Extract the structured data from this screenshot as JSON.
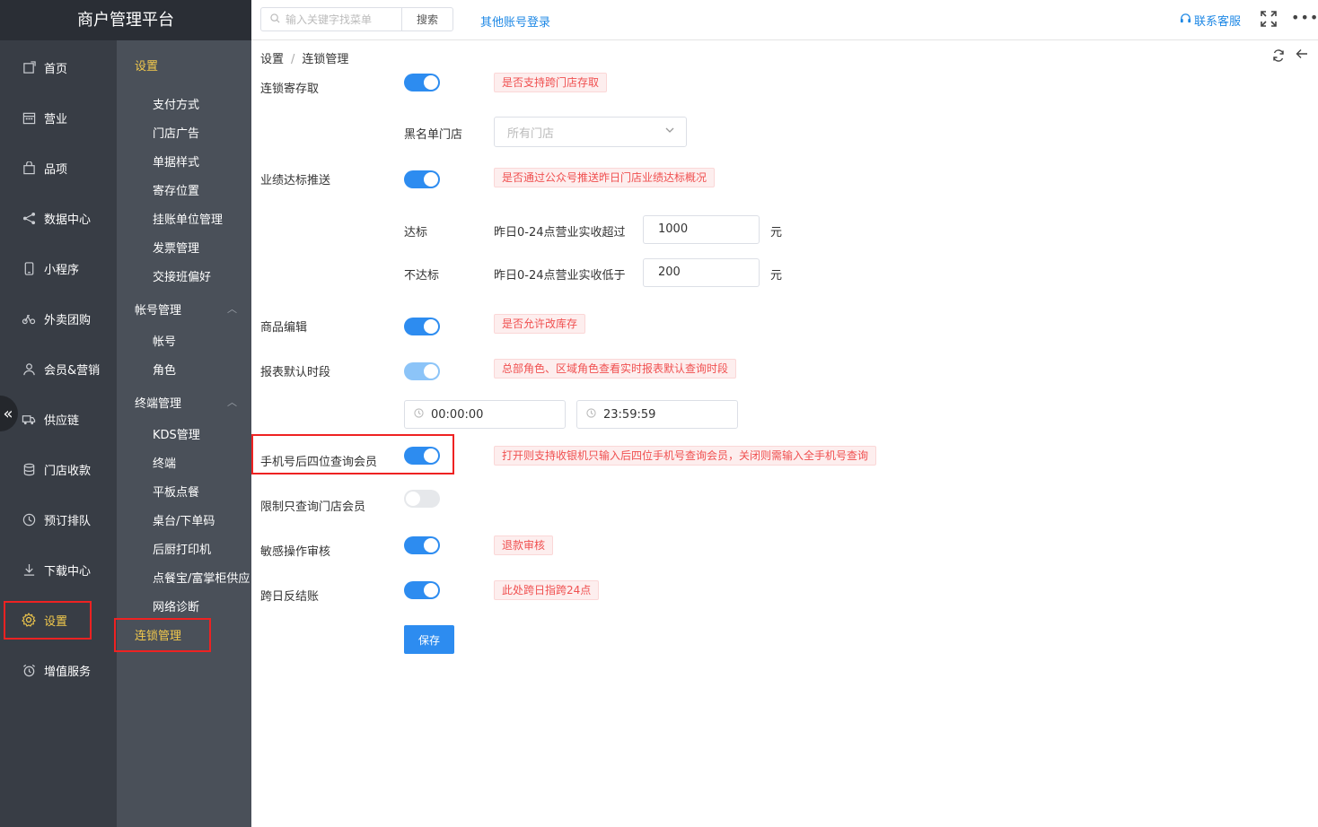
{
  "app_title": "商户管理平台",
  "sidebar": {
    "items": [
      {
        "label": "首页",
        "icon": "home-icon"
      },
      {
        "label": "营业",
        "icon": "calendar-icon"
      },
      {
        "label": "品项",
        "icon": "bag-icon"
      },
      {
        "label": "数据中心",
        "icon": "share-icon"
      },
      {
        "label": "小程序",
        "icon": "phone-icon"
      },
      {
        "label": "外卖团购",
        "icon": "bike-icon"
      },
      {
        "label": "会员&营销",
        "icon": "user-icon"
      },
      {
        "label": "供应链",
        "icon": "truck-icon"
      },
      {
        "label": "门店收款",
        "icon": "database-icon"
      },
      {
        "label": "预订排队",
        "icon": "clock-icon"
      },
      {
        "label": "下载中心",
        "icon": "download-icon"
      },
      {
        "label": "设置",
        "icon": "gear-icon",
        "active": true
      },
      {
        "label": "增值服务",
        "icon": "alarm-icon"
      }
    ],
    "collapse_icon": "double-chevron-left-icon"
  },
  "subnav": {
    "title": "设置",
    "settings_items": [
      "支付方式",
      "门店广告",
      "单据样式",
      "寄存位置",
      "挂账单位管理",
      "发票管理",
      "交接班偏好"
    ],
    "account_group": "帐号管理",
    "account_items": [
      "帐号",
      "角色"
    ],
    "terminal_group": "终端管理",
    "terminal_items": [
      "KDS管理",
      "终端",
      "平板点餐",
      "桌台/下单码",
      "后厨打印机",
      "点餐宝/富掌柜供应",
      "网络诊断"
    ],
    "active_item": "连锁管理"
  },
  "topbar": {
    "search_placeholder": "输入关键字找菜单",
    "search_button": "搜索",
    "other_login": "其他账号登录",
    "contact": "联系客服",
    "fullscreen_icon": "fullscreen-icon",
    "more_icon": "more-icon"
  },
  "breadcrumb": {
    "root": "设置",
    "sep": "/",
    "current": "连锁管理"
  },
  "form": {
    "chain_storage": {
      "label": "连锁寄存取",
      "hint": "是否支持跨门店存取",
      "enabled": true
    },
    "blacklist": {
      "label": "黑名单门店",
      "placeholder": "所有门店"
    },
    "performance_push": {
      "label": "业绩达标推送",
      "hint": "是否通过公众号推送昨日门店业绩达标概况",
      "enabled": true
    },
    "reach": {
      "label": "达标",
      "desc": "昨日0-24点营业实收超过",
      "value": "1000",
      "unit": "元"
    },
    "not_reach": {
      "label": "不达标",
      "desc": "昨日0-24点营业实收低于",
      "value": "200",
      "unit": "元"
    },
    "goods_edit": {
      "label": "商品编辑",
      "hint": "是否允许改库存",
      "enabled": true
    },
    "report_period": {
      "label": "报表默认时段",
      "hint": "总部角色、区域角色查看实时报表默认查询时段",
      "enabled": true,
      "start": "00:00:00",
      "end": "23:59:59"
    },
    "phone_last4": {
      "label": "手机号后四位查询会员",
      "hint": "打开则支持收银机只输入后四位手机号查询会员，关闭则需输入全手机号查询",
      "enabled": true
    },
    "limit_store_member": {
      "label": "限制只查询门店会员",
      "enabled": false
    },
    "sensitive_audit": {
      "label": "敏感操作审核",
      "hint": "退款审核",
      "enabled": true
    },
    "cross_day": {
      "label": "跨日反结账",
      "hint": "此处跨日指跨24点",
      "enabled": true
    },
    "save_button": "保存"
  },
  "colors": {
    "accent": "#2d8cf0",
    "sidebar_bg": "#383d45",
    "subnav_bg": "#4a5059",
    "active_text": "#f2c94c",
    "hint_text": "#f05050",
    "highlight_box": "#ee2222"
  }
}
